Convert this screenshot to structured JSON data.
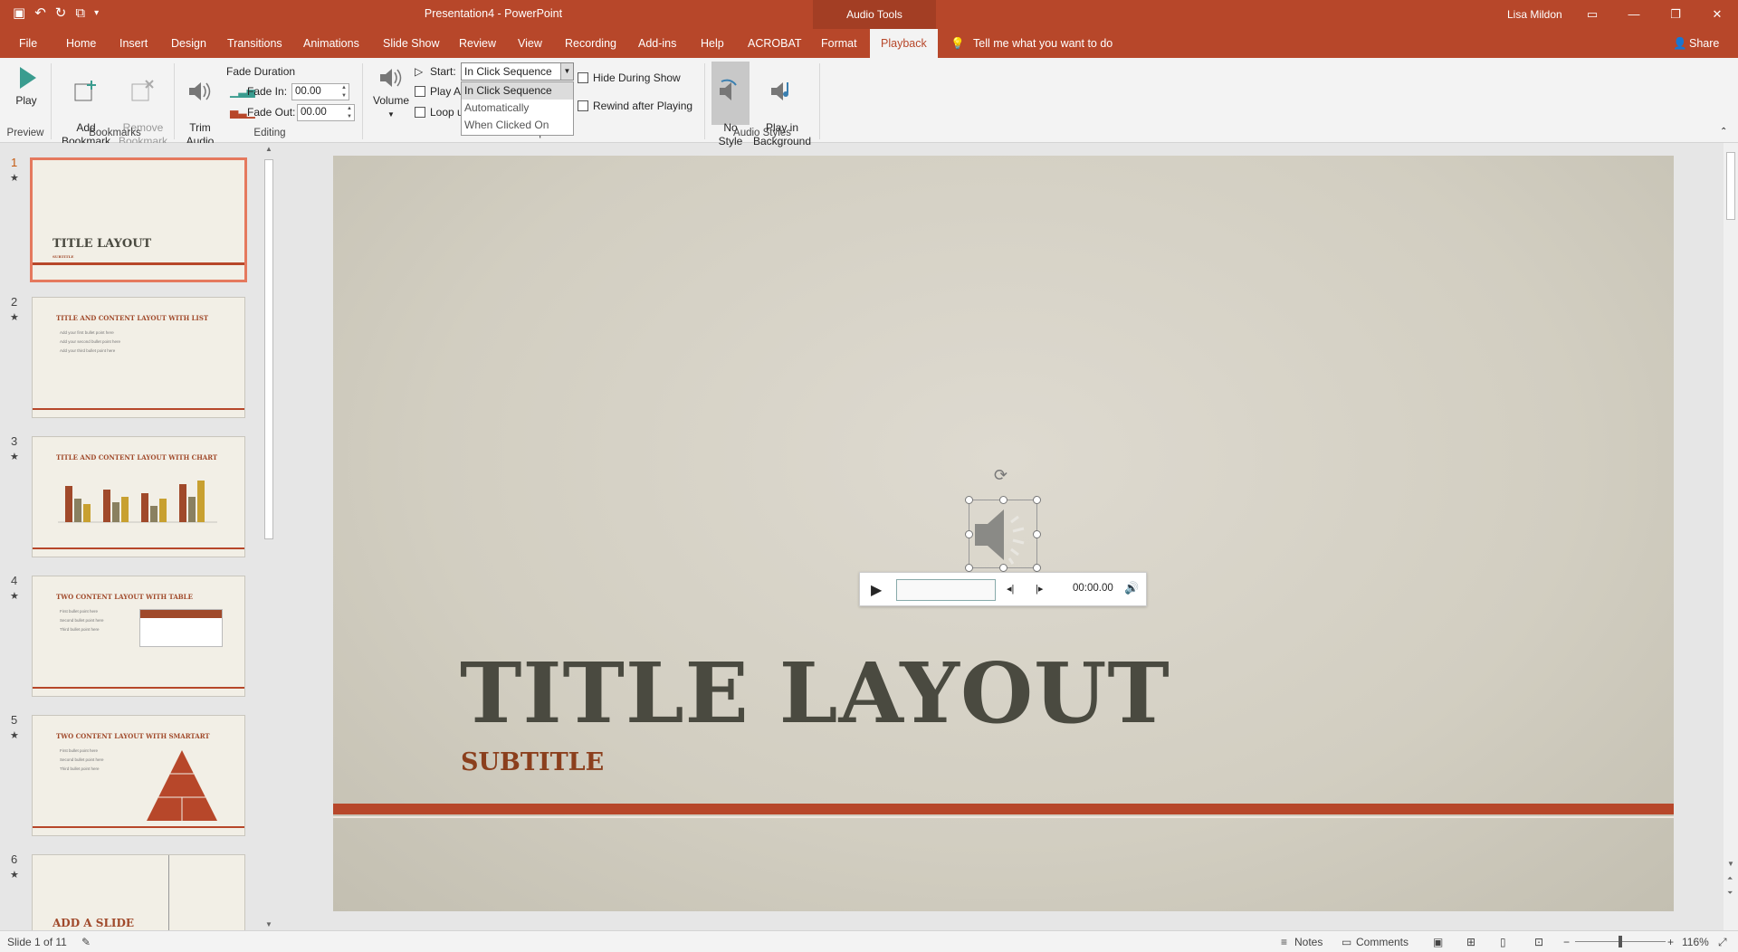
{
  "app": {
    "document_title": "Presentation4 - PowerPoint",
    "context_tab": "Audio Tools",
    "user": "Lisa Mildon",
    "tell_me": "Tell me what you want to do",
    "share": "Share"
  },
  "tabs": [
    {
      "label": "File"
    },
    {
      "label": "Home"
    },
    {
      "label": "Insert"
    },
    {
      "label": "Design"
    },
    {
      "label": "Transitions"
    },
    {
      "label": "Animations"
    },
    {
      "label": "Slide Show"
    },
    {
      "label": "Review"
    },
    {
      "label": "View"
    },
    {
      "label": "Recording"
    },
    {
      "label": "Add-ins"
    },
    {
      "label": "Help"
    },
    {
      "label": "ACROBAT"
    },
    {
      "label": "Format"
    },
    {
      "label": "Playback"
    }
  ],
  "ribbon": {
    "play": "Play",
    "preview_group": "Preview",
    "add_bookmark": "Add\nBookmark",
    "remove_bookmark": "Remove\nBookmark",
    "bookmarks_group": "Bookmarks",
    "trim_audio": "Trim\nAudio",
    "fade_duration": "Fade Duration",
    "fade_in_label": "Fade In:",
    "fade_in_value": "00.00",
    "fade_out_label": "Fade Out:",
    "fade_out_value": "00.00",
    "editing_group": "Editing",
    "volume": "Volume",
    "start_label": "Start:",
    "start_value": "In Click Sequence",
    "start_options": [
      "In Click Sequence",
      "Automatically",
      "When Clicked On"
    ],
    "play_across": "Play A",
    "loop_until": "Loop u",
    "hide_during_show": "Hide During Show",
    "rewind_after_playing": "Rewind after Playing",
    "audio_options_group": "Audio Options",
    "no_style": "No\nStyle",
    "play_in_background": "Play in\nBackground",
    "audio_styles_group": "Audio Styles"
  },
  "slides": [
    {
      "num": "1",
      "title": "TITLE LAYOUT",
      "subtitle": "SUBTITLE"
    },
    {
      "num": "2",
      "title": "TITLE AND CONTENT LAYOUT WITH LIST",
      "bullets": [
        "Add your first bullet point here",
        "Add your second bullet point here",
        "Add your third bullet point here"
      ]
    },
    {
      "num": "3",
      "title": "TITLE AND CONTENT LAYOUT WITH CHART"
    },
    {
      "num": "4",
      "title": "TWO CONTENT LAYOUT WITH TABLE",
      "bullets": [
        "First bullet point here",
        "Second bullet point here",
        "Third bullet point here"
      ]
    },
    {
      "num": "5",
      "title": "TWO CONTENT LAYOUT WITH SMARTART",
      "bullets": [
        "First bullet point here",
        "Second bullet point here",
        "Third bullet point here"
      ]
    },
    {
      "num": "6",
      "title": "ADD A SLIDE"
    }
  ],
  "main_slide": {
    "title": "TITLE LAYOUT",
    "subtitle": "SUBTITLE",
    "player_time": "00:00.00"
  },
  "status": {
    "slide_indicator": "Slide 1 of 11",
    "notes": "Notes",
    "comments": "Comments",
    "zoom": "116%"
  },
  "colors": {
    "accent": "#b7472a",
    "ribbon_bg": "#f3f3f3"
  }
}
